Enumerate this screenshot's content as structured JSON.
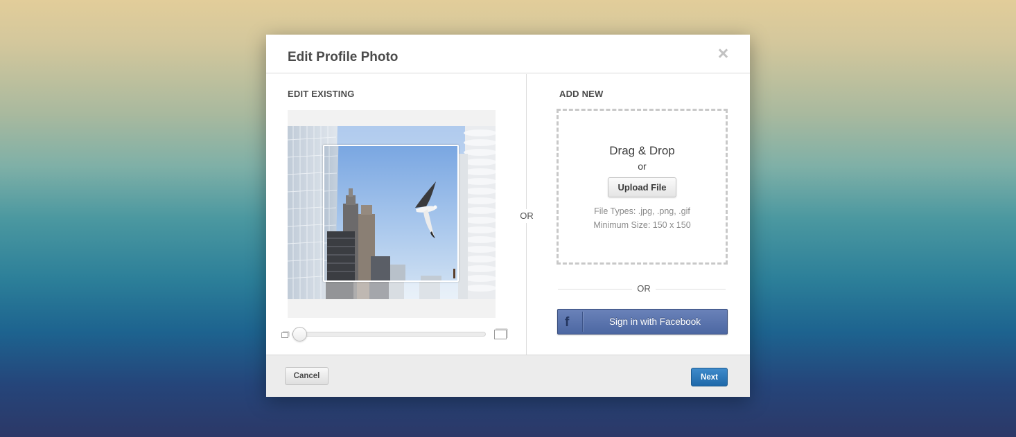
{
  "modal": {
    "title": "Edit Profile Photo",
    "close_icon": "close-icon"
  },
  "edit_existing": {
    "heading": "EDIT EXISTING",
    "zoom": {
      "level": 0.0,
      "min_icon": "small-square-icon",
      "max_icon": "large-square-icon"
    }
  },
  "separator_label": "OR",
  "add_new": {
    "heading": "ADD NEW",
    "dropzone": {
      "title": "Drag & Drop",
      "or_text": "or",
      "upload_label": "Upload File",
      "file_types": "File Types: .jpg, .png, .gif",
      "min_size": "Minimum Size: 150 x 150"
    },
    "or_text": "OR",
    "facebook": {
      "icon_letter": "f",
      "label": "Sign in with Facebook",
      "color": "#4c67a2"
    }
  },
  "footer": {
    "cancel_label": "Cancel",
    "next_label": "Next",
    "next_color": "#1e68a9"
  }
}
